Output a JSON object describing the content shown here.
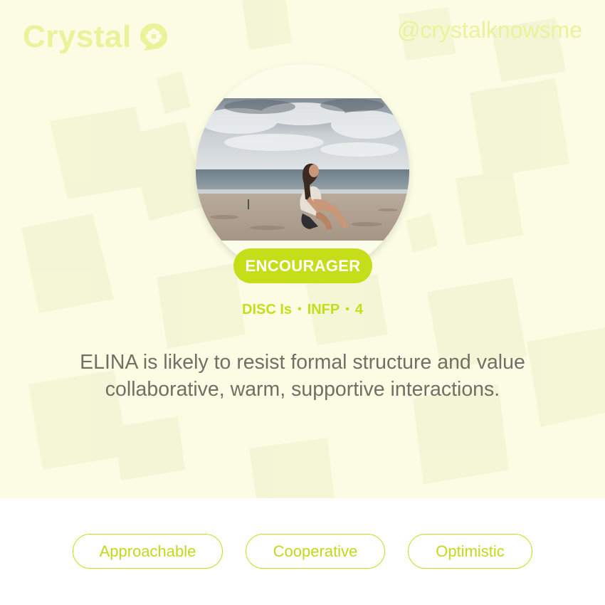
{
  "brand": {
    "logo_text": "Crystal",
    "handle": "@crystalknowsme",
    "accent_color": "#c6dd19",
    "logo_color": "#eaf29a"
  },
  "profile": {
    "photo_description": "photo-icon",
    "archetype": "ENCOURAGER",
    "disc": "DISC Is",
    "mbti": "INFP",
    "enneagram": "4",
    "separator": "•",
    "description": "ELINA is likely to resist formal structure and value collaborative, warm, supportive interactions."
  },
  "traits": [
    {
      "label": "Approachable"
    },
    {
      "label": "Cooperative"
    },
    {
      "label": "Optimistic"
    }
  ]
}
